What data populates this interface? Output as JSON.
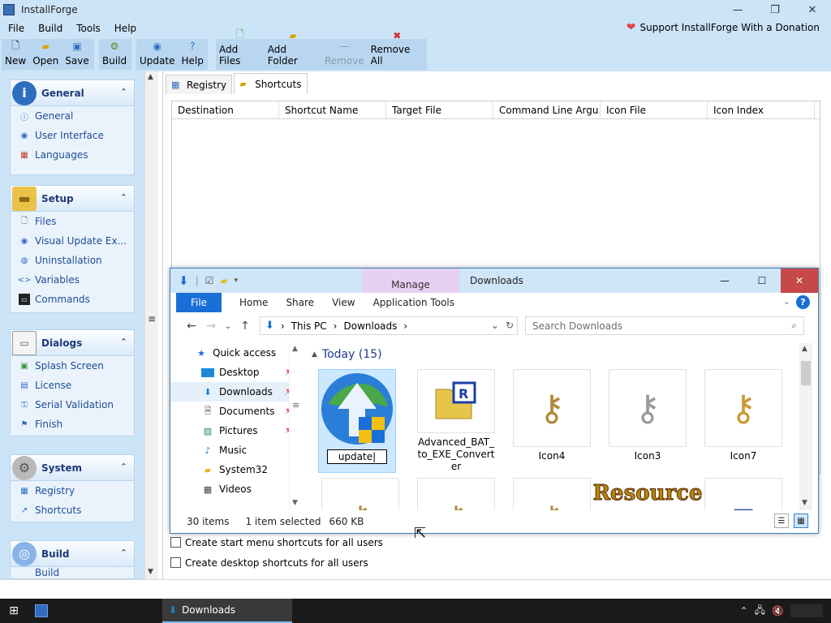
{
  "app": {
    "title": "InstallForge",
    "donate": "Support InstallForge With a Donation"
  },
  "menu": [
    "File",
    "Build",
    "Tools",
    "Help"
  ],
  "toolbar": {
    "group1": [
      "New",
      "Open",
      "Save"
    ],
    "group2": [
      "Build"
    ],
    "group3": [
      "Update",
      "Help"
    ],
    "group4": [
      "Add Files",
      "Add Folder",
      "Remove",
      "Remove All"
    ]
  },
  "sidebar": {
    "groups": [
      {
        "name": "General",
        "items": [
          "General",
          "User Interface",
          "Languages"
        ]
      },
      {
        "name": "Setup",
        "items": [
          "Files",
          "Visual Update Ex...",
          "Uninstallation",
          "Variables",
          "Commands"
        ]
      },
      {
        "name": "Dialogs",
        "items": [
          "Splash Screen",
          "License",
          "Serial Validation",
          "Finish"
        ]
      },
      {
        "name": "System",
        "items": [
          "Registry",
          "Shortcuts"
        ]
      },
      {
        "name": "Build",
        "items": [
          "Build"
        ]
      }
    ]
  },
  "tabs": [
    "Registry",
    "Shortcuts"
  ],
  "grid_columns": [
    "Destination",
    "Shortcut Name",
    "Target File",
    "Command Line Argu...",
    "Icon File",
    "Icon Index"
  ],
  "checks": [
    "Create start menu shortcuts for all users",
    "Create desktop shortcuts for all users"
  ],
  "explorer": {
    "title": "Downloads",
    "manage": "Manage",
    "ribbon": {
      "file": "File",
      "tabs": [
        "Home",
        "Share",
        "View",
        "Application Tools"
      ]
    },
    "address": [
      "This PC",
      "Downloads"
    ],
    "search_placeholder": "Search Downloads",
    "nav": [
      "Quick access",
      "Desktop",
      "Downloads",
      "Documents",
      "Pictures",
      "Music",
      "System32",
      "Videos"
    ],
    "group_header": "Today (15)",
    "files": [
      {
        "name": "update",
        "renaming": true
      },
      {
        "name": "Advanced_BAT_to_EXE_Converter"
      },
      {
        "name": "Icon4"
      },
      {
        "name": "Icon3"
      },
      {
        "name": "Icon7"
      }
    ],
    "resource_label": "Resource",
    "status": {
      "items": "30 items",
      "selected": "1 item selected",
      "size": "660 KB"
    }
  },
  "taskbar": {
    "item": "Downloads"
  }
}
